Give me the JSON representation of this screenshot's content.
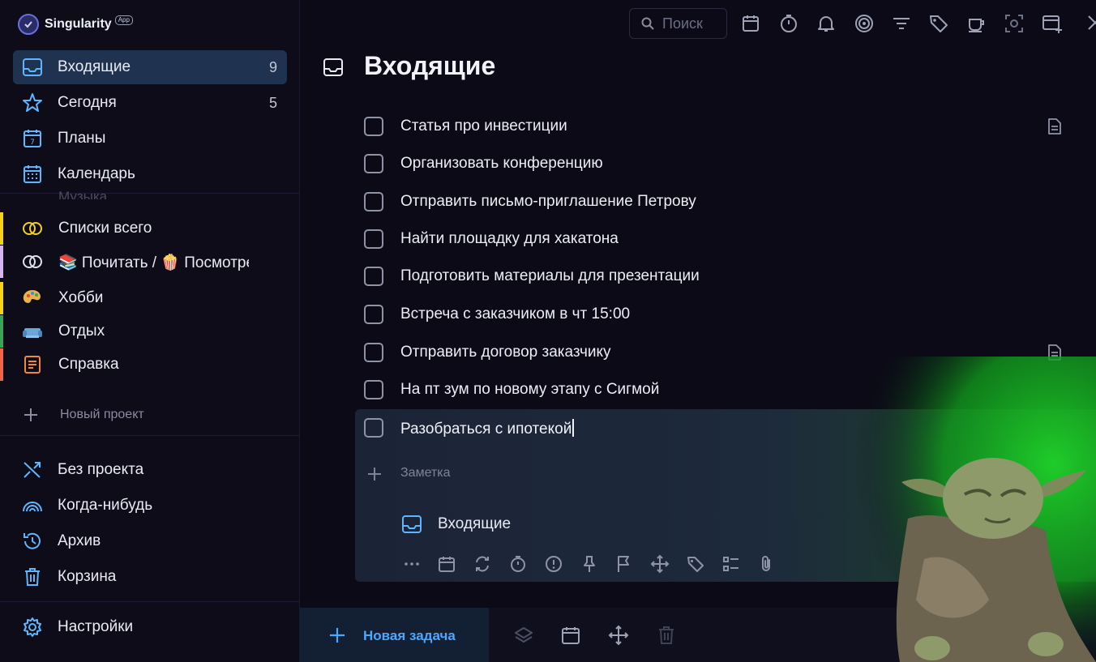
{
  "app": {
    "name": "Singularity",
    "badge": "App"
  },
  "sidebar": {
    "main": [
      {
        "label": "Входящие",
        "count": "9",
        "icon": "inbox-icon",
        "active": true
      },
      {
        "label": "Сегодня",
        "count": "5",
        "icon": "star-icon"
      },
      {
        "label": "Планы",
        "count": "",
        "icon": "calendar-7-icon"
      },
      {
        "label": "Календарь",
        "count": "",
        "icon": "calendar-grid-icon"
      }
    ],
    "faded_item": "Музыка",
    "projects": [
      {
        "label": "Списки всего",
        "icon": "rings-icon",
        "color": "#f2d21a"
      },
      {
        "label": "📚 Почитать / 🍿 Посмотреть",
        "icon": "rings-icon",
        "color": "#d9b5f0"
      },
      {
        "label": "Хобби",
        "icon": "palette-icon",
        "color": "#f2d21a"
      },
      {
        "label": "Отдых",
        "icon": "sofa-icon",
        "color": "#3aa35a"
      },
      {
        "label": "Справка",
        "icon": "notes-icon",
        "color": "#f0654a"
      }
    ],
    "new_project": "Новый проект",
    "bottom": [
      {
        "label": "Без проекта",
        "icon": "shuffle-icon"
      },
      {
        "label": "Когда-нибудь",
        "icon": "rainbow-icon"
      },
      {
        "label": "Архив",
        "icon": "history-icon"
      },
      {
        "label": "Корзина",
        "icon": "trash-icon"
      }
    ],
    "settings": "Настройки"
  },
  "toolbar": {
    "search_placeholder": "Поиск",
    "icons": [
      "calendar-icon",
      "timer-icon",
      "bell-icon",
      "focus-icon",
      "filter-icon",
      "tag-icon",
      "coffee-icon",
      "screenshot-icon",
      "new-window-icon"
    ]
  },
  "page": {
    "title": "Входящие"
  },
  "tasks": [
    {
      "label": "Статья про инвестиции",
      "has_note": true
    },
    {
      "label": "Организовать конференцию",
      "has_note": false
    },
    {
      "label": "Отправить письмо-приглашение Петрову",
      "has_note": false
    },
    {
      "label": "Найти площадку для хакатона",
      "has_note": false
    },
    {
      "label": "Подготовить материалы для презентации",
      "has_note": false
    },
    {
      "label": "Встреча с заказчиком в чт 15:00",
      "has_note": false
    },
    {
      "label": "Отправить договор заказчику",
      "has_note": true
    },
    {
      "label": "На пт зум по новому этапу с Сигмой",
      "has_note": false
    }
  ],
  "editor": {
    "title": "Разобраться с ипотекой",
    "note_placeholder": "Заметка",
    "project": "Входящие",
    "tools": [
      "more-icon",
      "calendar-icon",
      "repeat-icon",
      "timer-icon",
      "priority-icon",
      "pin-icon",
      "flag-icon",
      "move-icon",
      "tag-icon",
      "checklist-icon",
      "attach-icon"
    ]
  },
  "bottombar": {
    "new_task": "Новая задача",
    "icons": [
      "layers-icon",
      "calendar-icon",
      "move-icon",
      "trash-icon"
    ]
  },
  "colors": {
    "accent": "#4aa8ff",
    "active_bg": "#1f3350",
    "background": "#0b0a16"
  }
}
